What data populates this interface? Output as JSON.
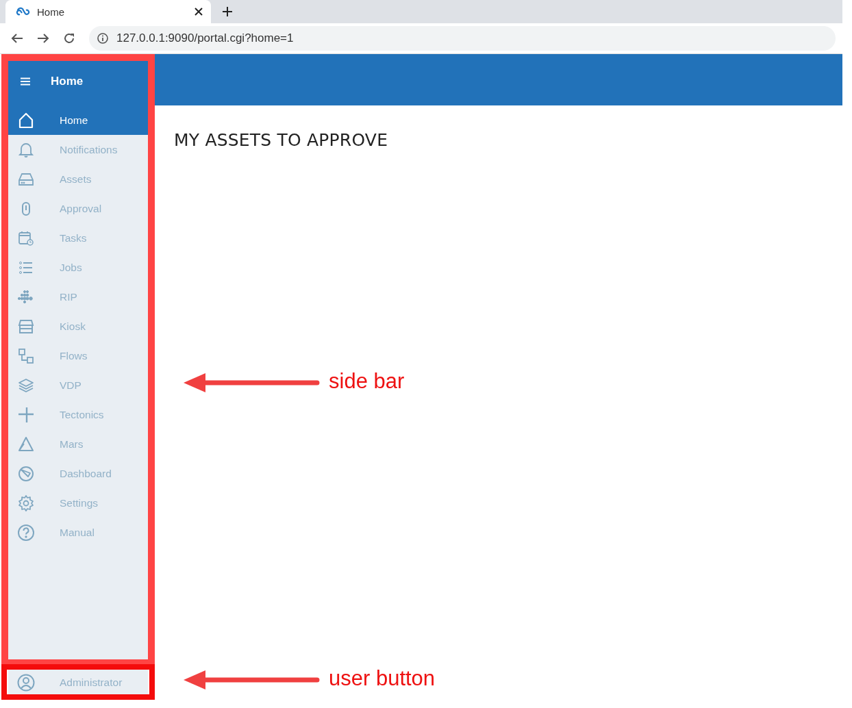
{
  "browser": {
    "tab_title": "Home",
    "address": "127.0.0.1:9090/portal.cgi?home=1"
  },
  "sidebar": {
    "title": "Home",
    "items": [
      {
        "label": "Home",
        "selected": true
      },
      {
        "label": "Notifications",
        "selected": false
      },
      {
        "label": "Assets",
        "selected": false
      },
      {
        "label": "Approval",
        "selected": false
      },
      {
        "label": "Tasks",
        "selected": false
      },
      {
        "label": "Jobs",
        "selected": false
      },
      {
        "label": "RIP",
        "selected": false
      },
      {
        "label": "Kiosk",
        "selected": false
      },
      {
        "label": "Flows",
        "selected": false
      },
      {
        "label": "VDP",
        "selected": false
      },
      {
        "label": "Tectonics",
        "selected": false
      },
      {
        "label": "Mars",
        "selected": false
      },
      {
        "label": "Dashboard",
        "selected": false
      },
      {
        "label": "Settings",
        "selected": false
      },
      {
        "label": "Manual",
        "selected": false
      }
    ],
    "user": {
      "label": "Administrator"
    }
  },
  "main": {
    "heading": "MY ASSETS TO APPROVE"
  },
  "callouts": [
    {
      "label": "side bar"
    },
    {
      "label": "user button"
    }
  ]
}
